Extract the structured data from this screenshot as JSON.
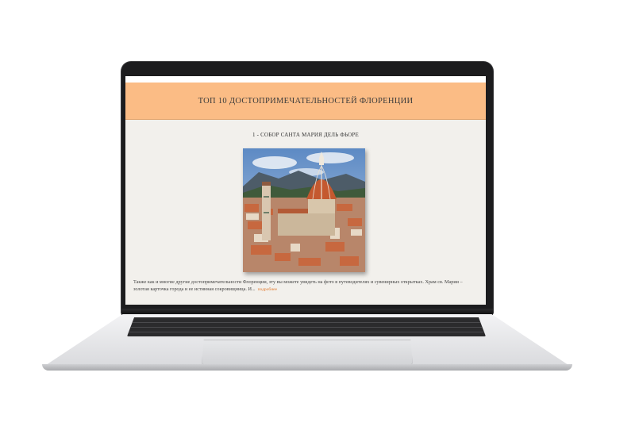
{
  "page": {
    "banner_title": "ТОП 10 ДОСТОПРИМЕЧАТЕЛЬНОСТЕЙ ФЛОРЕНЦИИ",
    "section_title": "1 - СОБОР САНТА МАРИЯ ДЕЛЬ ФЬОРЕ",
    "excerpt": "Также как и многие другие достопримечательности Флоренции, эту вы можете увидеть на фото в путеводителях и сувенирных открытках. Храм св. Марии – золотая карточка города и ее истинная сокровищница. И...",
    "read_more": "подробнее"
  },
  "colors": {
    "banner": "#fbbc85",
    "page_bg": "#f2f0ec",
    "link": "#e27a2e"
  }
}
